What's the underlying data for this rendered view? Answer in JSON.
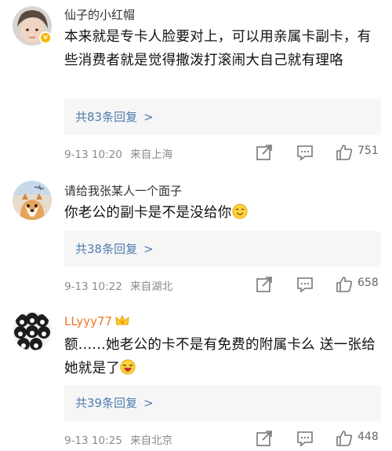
{
  "comments": [
    {
      "username": "仙子的小红帽",
      "text": "本来就是专卡人脸要对上，可以用亲属卡副卡，有些消费者就是觉得撒泼打滚闹大自己就有理咯",
      "reply_link": "共83条回复",
      "timestamp": "9-13 10:20",
      "location": "来自上海",
      "likes": "751",
      "verified": true
    },
    {
      "username": "请给我张某人一个面子",
      "text": "你老公的副卡是不是没给你",
      "reply_link": "共38条回复",
      "timestamp": "9-13 10:22",
      "location": "来自湖北",
      "likes": "658"
    },
    {
      "username": "LLyyy77",
      "text": "额......她老公的卡不是有免费的附属卡么 送一张给她就是了",
      "reply_link": "共39条回复",
      "timestamp": "9-13 10:25",
      "location": "来自北京",
      "likes": "448"
    }
  ],
  "icons": {
    "share": "share-icon",
    "comment": "comment-icon",
    "like": "thumbs-up-icon",
    "chevron": "chevron-right-icon"
  },
  "colors": {
    "link": "#4f7cae",
    "meta": "#8a8a8a",
    "vip_name": "#f3752a",
    "reply_bg": "#f6f6f6"
  }
}
